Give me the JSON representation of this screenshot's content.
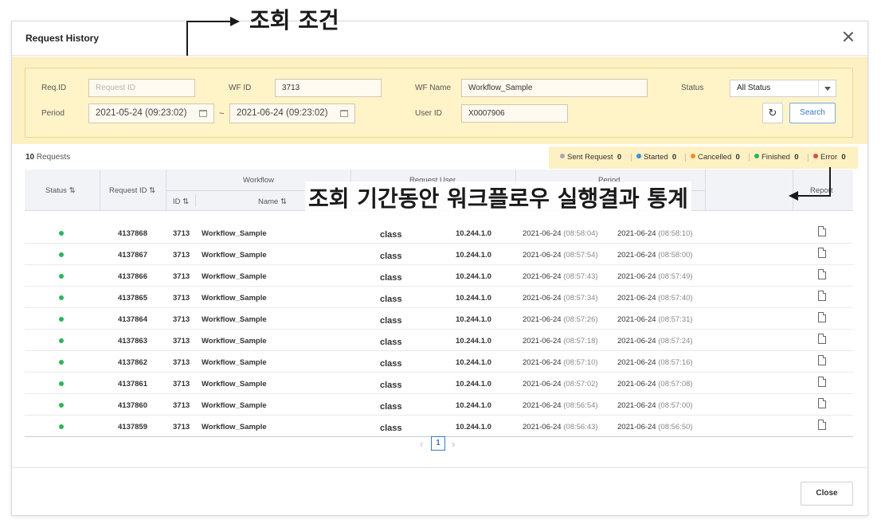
{
  "modal": {
    "title": "Request History"
  },
  "filters": {
    "req_id_label": "Req.ID",
    "req_id_placeholder": "Request ID",
    "wf_id_label": "WF ID",
    "wf_id_value": "3713",
    "wf_name_label": "WF Name",
    "wf_name_value": "Workflow_Sample",
    "status_label": "Status",
    "status_value": "All Status",
    "period_label": "Period",
    "period_from": "2021-05-24 (09:23:02)",
    "period_tilde": "~",
    "period_to": "2021-06-24 (09:23:02)",
    "user_id_label": "User ID",
    "user_id_value": "X0007906",
    "search_label": "Search"
  },
  "summary": {
    "count": "10",
    "count_suffix": " Requests"
  },
  "legend": [
    {
      "label": "Sent Request",
      "count": "0",
      "color": "#a8a8a8"
    },
    {
      "label": "Started",
      "count": "0",
      "color": "#3a8fd9"
    },
    {
      "label": "Cancelled",
      "count": "0",
      "color": "#f28c28"
    },
    {
      "label": "Finished",
      "count": "0",
      "color": "#2ab55a"
    },
    {
      "label": "Error",
      "count": "0",
      "color": "#e04848"
    }
  ],
  "table": {
    "headers": {
      "status": "Status",
      "request_id": "Request ID",
      "workflow": "Workflow",
      "wf_id": "ID",
      "wf_name": "Name",
      "request_user": "Request User",
      "period": "Period",
      "report": "Report",
      "sort_glyph": "⇅"
    },
    "rows": [
      {
        "request_id": "4137868",
        "wf_id": "3713",
        "name": "Workflow_Sample",
        "user": "class",
        "ip": "10.244.1.0",
        "start_date": "2021-06-24",
        "start_time": "(08:58:04)",
        "end_date": "2021-06-24",
        "end_time": "(08:58:10)"
      },
      {
        "request_id": "4137867",
        "wf_id": "3713",
        "name": "Workflow_Sample",
        "user": "class",
        "ip": "10.244.1.0",
        "start_date": "2021-06-24",
        "start_time": "(08:57:54)",
        "end_date": "2021-06-24",
        "end_time": "(08:58:00)"
      },
      {
        "request_id": "4137866",
        "wf_id": "3713",
        "name": "Workflow_Sample",
        "user": "class",
        "ip": "10.244.1.0",
        "start_date": "2021-06-24",
        "start_time": "(08:57:43)",
        "end_date": "2021-06-24",
        "end_time": "(08:57:49)"
      },
      {
        "request_id": "4137865",
        "wf_id": "3713",
        "name": "Workflow_Sample",
        "user": "class",
        "ip": "10.244.1.0",
        "start_date": "2021-06-24",
        "start_time": "(08:57:34)",
        "end_date": "2021-06-24",
        "end_time": "(08:57:40)"
      },
      {
        "request_id": "4137864",
        "wf_id": "3713",
        "name": "Workflow_Sample",
        "user": "class",
        "ip": "10.244.1.0",
        "start_date": "2021-06-24",
        "start_time": "(08:57:26)",
        "end_date": "2021-06-24",
        "end_time": "(08:57:31)"
      },
      {
        "request_id": "4137863",
        "wf_id": "3713",
        "name": "Workflow_Sample",
        "user": "class",
        "ip": "10.244.1.0",
        "start_date": "2021-06-24",
        "start_time": "(08:57:18)",
        "end_date": "2021-06-24",
        "end_time": "(08:57:24)"
      },
      {
        "request_id": "4137862",
        "wf_id": "3713",
        "name": "Workflow_Sample",
        "user": "class",
        "ip": "10.244.1.0",
        "start_date": "2021-06-24",
        "start_time": "(08:57:10)",
        "end_date": "2021-06-24",
        "end_time": "(08:57:16)"
      },
      {
        "request_id": "4137861",
        "wf_id": "3713",
        "name": "Workflow_Sample",
        "user": "class",
        "ip": "10.244.1.0",
        "start_date": "2021-06-24",
        "start_time": "(08:57:02)",
        "end_date": "2021-06-24",
        "end_time": "(08:57:08)"
      },
      {
        "request_id": "4137860",
        "wf_id": "3713",
        "name": "Workflow_Sample",
        "user": "class",
        "ip": "10.244.1.0",
        "start_date": "2021-06-24",
        "start_time": "(08:56:54)",
        "end_date": "2021-06-24",
        "end_time": "(08:57:00)"
      },
      {
        "request_id": "4137859",
        "wf_id": "3713",
        "name": "Workflow_Sample",
        "user": "class",
        "ip": "10.244.1.0",
        "start_date": "2021-06-24",
        "start_time": "(08:56:43)",
        "end_date": "2021-06-24",
        "end_time": "(08:56:50)"
      }
    ]
  },
  "status_color": "#2ab55a",
  "pagination": {
    "prev": "‹",
    "current": "1",
    "next": "›"
  },
  "footer": {
    "close_label": "Close"
  },
  "annotations": {
    "search_conditions": "조회 조건",
    "period_stats": "조회 기간동안 워크플로우 실행결과 통계"
  }
}
